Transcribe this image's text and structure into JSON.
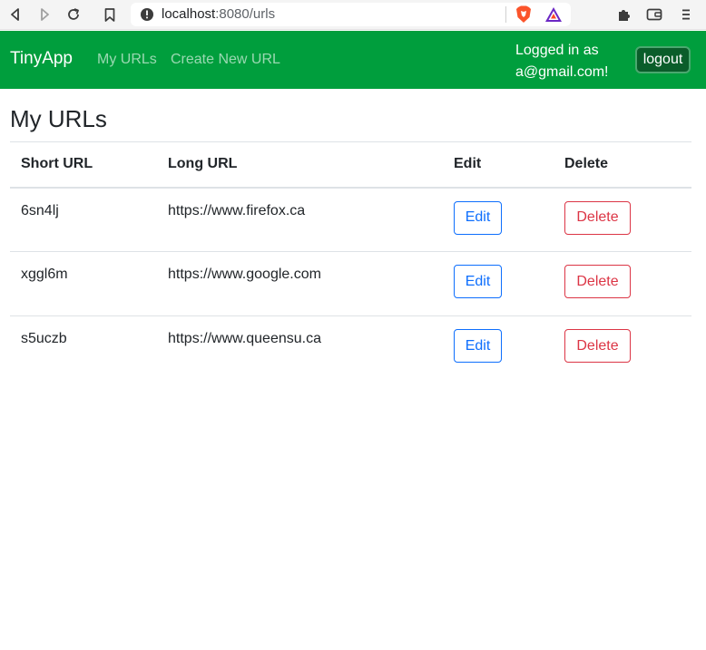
{
  "browser": {
    "address_host": "localhost",
    "address_path": ":8080/urls"
  },
  "navbar": {
    "brand": "TinyApp",
    "links": [
      "My URLs",
      "Create New URL"
    ],
    "login_line1": "Logged in as",
    "login_line2": "a@gmail.com!",
    "logout_label": "logout"
  },
  "main": {
    "title": "My URLs",
    "headers": [
      "Short URL",
      "Long URL",
      "Edit",
      "Delete"
    ],
    "rows": [
      {
        "short": "6sn4lj",
        "long": "https://www.firefox.ca",
        "edit": "Edit",
        "delete": "Delete"
      },
      {
        "short": "xggl6m",
        "long": "https://www.google.com",
        "edit": "Edit",
        "delete": "Delete"
      },
      {
        "short": "s5uczb",
        "long": "https://www.queensu.ca",
        "edit": "Edit",
        "delete": "Delete"
      }
    ]
  },
  "colors": {
    "navbar": "#009e3d",
    "edit": "#0d6efd",
    "delete": "#dc3545"
  }
}
